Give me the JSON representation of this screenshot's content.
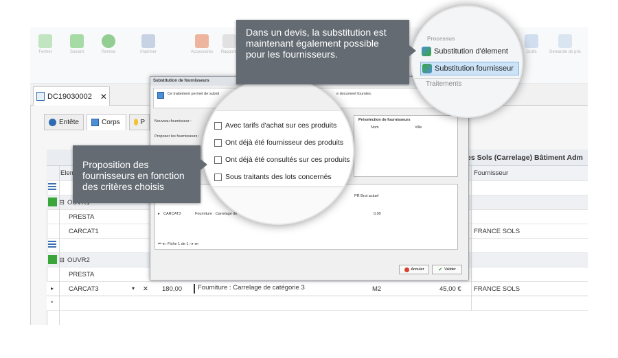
{
  "ribbon": {
    "buttons": [
      "Fermer",
      "Suivant",
      "Remise",
      "Imprimer",
      "Accessoires",
      "Rapports",
      "Prix",
      "Fournisseurs",
      "Recalculer",
      "Outils",
      "Demande de prix",
      "Créer fabrication"
    ]
  },
  "doc_tab": {
    "title": "DC19030002",
    "close": "✕"
  },
  "sub_tabs": {
    "entete": "Entête",
    "corps": "Corps",
    "third": "P"
  },
  "grid": {
    "header_left": "Elem",
    "header_right_group": "es Sols (Carrelage) Bâtiment Adm",
    "header_fournisseur": "Fournisseur",
    "rows": [
      {
        "code": "",
        "type": "icon"
      },
      {
        "code": "OUVR1",
        "type": "group"
      },
      {
        "code": "PRESTA",
        "type": "child"
      },
      {
        "code": "CARCAT1",
        "type": "child",
        "fournisseur": "FRANCE SOLS"
      },
      {
        "code": "",
        "type": "icon"
      },
      {
        "code": "OUVR2",
        "type": "group"
      },
      {
        "code": "PRESTA",
        "type": "child"
      },
      {
        "code": "CARCAT3",
        "type": "edit",
        "qty": "180,00",
        "desc": "Fourniture : Carrelage de catégorie 3",
        "unit": "M2",
        "price": "45,00 €",
        "fournisseur": "FRANCE SOLS"
      }
    ],
    "new_row_marker": "*"
  },
  "dialog": {
    "title": "Substitution de fournisseurs",
    "info": "Ce traitement permet de substi",
    "info_tail": "e document fournies.",
    "nouveau_label": "Nouveau fournisseur :",
    "proposer_label": "Proposer les fournisseurs :",
    "preselection_title": "Préselection de fournisseurs",
    "col_nom": "Nom",
    "col_ville": "Ville",
    "inner_col_pr": "PR Brut actuel",
    "inner_row_code": "CARCAT3",
    "inner_row_desc": "Fourniture : Carrelage de",
    "inner_row_value": "0,00",
    "pager": "Fiche 1 de 1",
    "btn_annuler": "Annuler",
    "btn_valider": "Valider"
  },
  "magnifier_options": {
    "items": [
      "Avec tarifs d'achat sur ces produits",
      "Ont déjà été fournisseur des produits",
      "Ont déjà été consultés sur ces produits",
      "Sous traitants des lots concernés"
    ]
  },
  "magnifier_ribbon": {
    "group_title": "Processus",
    "item1": "Substitution d'élement",
    "item2": "Substitution fournisseur",
    "section": "Traitements"
  },
  "callouts": {
    "top": "Dans un devis, la substitution est maintenant également possible pour les fournisseurs.",
    "left": "Proposition des fournisseurs en fonction des critères choisis"
  },
  "colors": {
    "callout_bg": "#646b73",
    "selected_item": "#cde3f7",
    "accent_green": "#3aa63a"
  }
}
